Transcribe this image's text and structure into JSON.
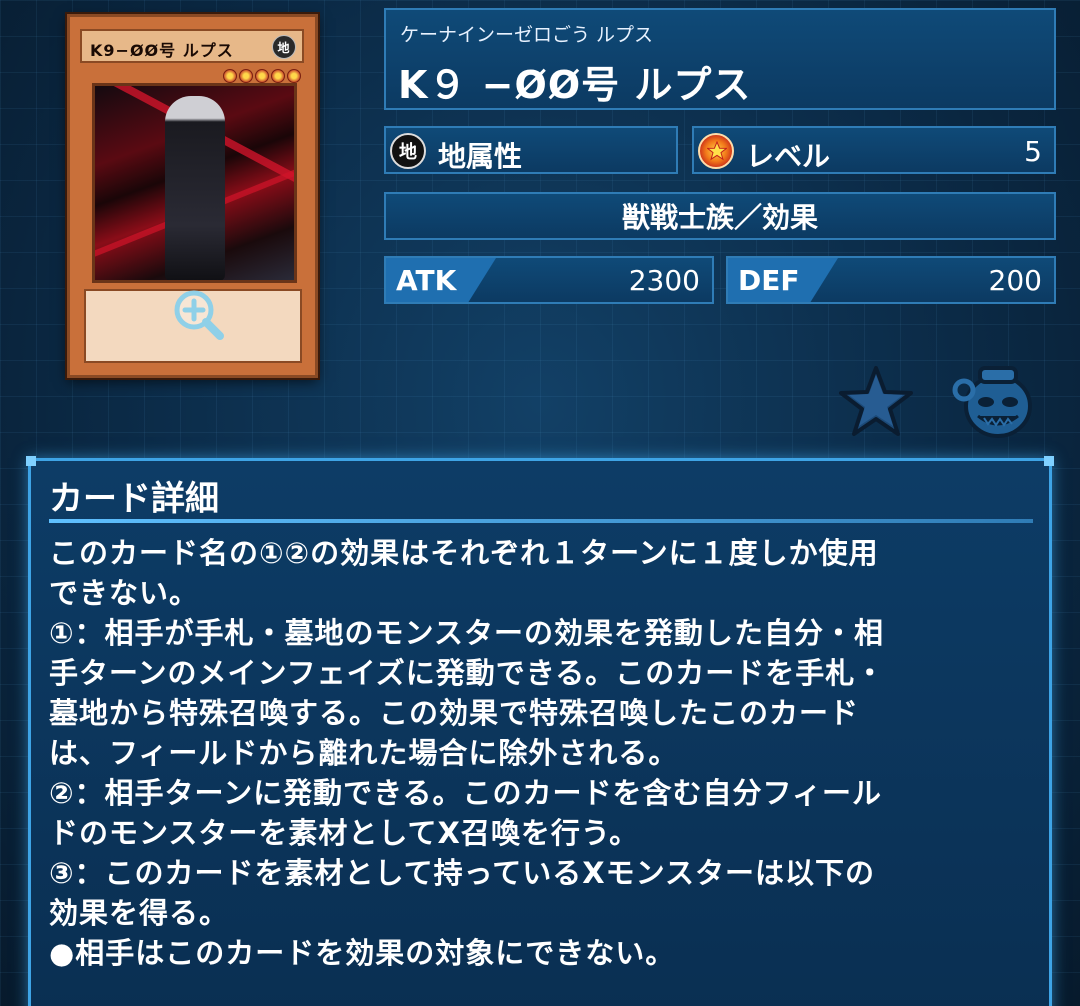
{
  "card_image": {
    "name_text": "K9−ØØ号 ルプス",
    "attribute_glyph": "地",
    "stars": 5
  },
  "header": {
    "ruby": "ケーナインーゼロごう ルプス",
    "name": "K９ −ØØ号 ルプス"
  },
  "attribute": {
    "glyph": "地",
    "label": "地属性"
  },
  "level": {
    "label": "レベル",
    "value": "5"
  },
  "type_line": "獣戦士族／効果",
  "stats": {
    "atk_label": "ATK",
    "atk_value": "2300",
    "def_label": "DEF",
    "def_value": "200"
  },
  "icons": {
    "favorite": "star-icon",
    "pot": "pot-of-greed-icon",
    "zoom": "zoom-icon"
  },
  "detail": {
    "title": "カード詳細",
    "lines": [
      "このカード名の①②の効果はそれぞれ１ターンに１度しか使用",
      "できない。",
      "①：相手が手札・墓地のモンスターの効果を発動した自分・相",
      "手ターンのメインフェイズに発動できる。このカードを手札・",
      "墓地から特殊召喚する。この効果で特殊召喚したこのカード",
      "は、フィールドから離れた場合に除外される。",
      "②：相手ターンに発動できる。このカードを含む自分フィール",
      "ドのモンスターを素材としてX召喚を行う。",
      "③：このカードを素材として持っているXモンスターは以下の",
      "効果を得る。",
      "●相手はこのカードを効果の対象にできない。"
    ]
  },
  "colors": {
    "background": "#0b2840",
    "panel": "#0f4a78",
    "panel_border": "#2f7cb6",
    "accent": "#3ea4e6",
    "card_frame": "#c9703a"
  }
}
